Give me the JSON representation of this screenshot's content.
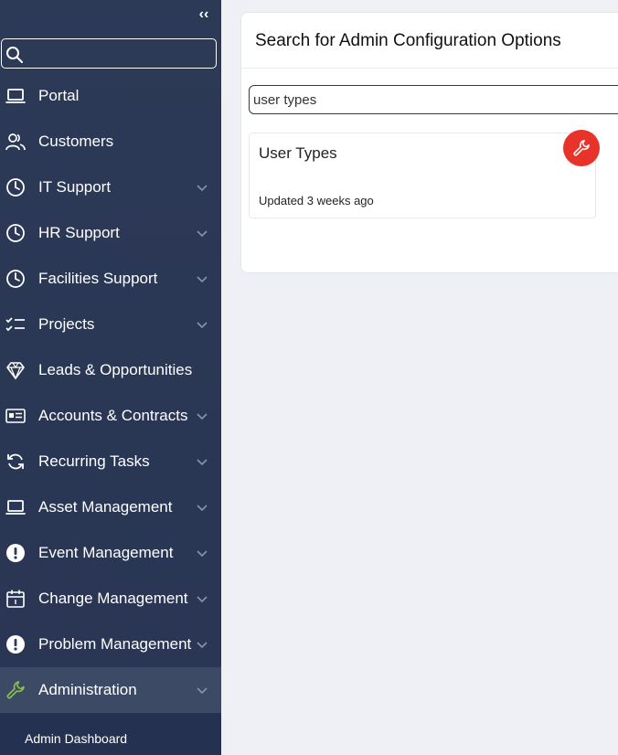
{
  "sidebar": {
    "collapse_label": "‹‹",
    "search": {
      "value": "",
      "placeholder": ""
    },
    "items": [
      {
        "label": "Portal",
        "icon": "laptop-icon",
        "has_chevron": false
      },
      {
        "label": "Customers",
        "icon": "users-icon",
        "has_chevron": false
      },
      {
        "label": "IT Support",
        "icon": "clock-icon",
        "has_chevron": true
      },
      {
        "label": "HR Support",
        "icon": "clock-icon",
        "has_chevron": true
      },
      {
        "label": "Facilities Support",
        "icon": "clock-icon",
        "has_chevron": true
      },
      {
        "label": "Projects",
        "icon": "checklist-icon",
        "has_chevron": true
      },
      {
        "label": "Leads & Opportunities",
        "icon": "diamond-icon",
        "has_chevron": false
      },
      {
        "label": "Accounts & Contracts",
        "icon": "id-card-icon",
        "has_chevron": true
      },
      {
        "label": "Recurring Tasks",
        "icon": "refresh-icon",
        "has_chevron": true
      },
      {
        "label": "Asset Management",
        "icon": "laptop-icon",
        "has_chevron": true
      },
      {
        "label": "Event Management",
        "icon": "alert-circle-icon",
        "has_chevron": true
      },
      {
        "label": "Change Management",
        "icon": "calendar-icon",
        "has_chevron": true
      },
      {
        "label": "Problem Management",
        "icon": "alert-circle-icon",
        "has_chevron": true
      },
      {
        "label": "Administration",
        "icon": "wrench-icon",
        "has_chevron": true,
        "active": true
      }
    ],
    "subitem": {
      "label": "Admin Dashboard"
    }
  },
  "main": {
    "title": "Search for Admin Configuration Options",
    "search": {
      "value": "user types"
    },
    "results": [
      {
        "title": "User Types",
        "updated": "Updated 3 weeks ago",
        "icon": "wrench-icon"
      }
    ]
  },
  "colors": {
    "sidebar_bg": "#2d3a57",
    "active_item_bg": "#3d4a66",
    "accent_green": "#8bc34a",
    "badge_red": "#e8332a",
    "page_bg": "#eef0f6"
  }
}
